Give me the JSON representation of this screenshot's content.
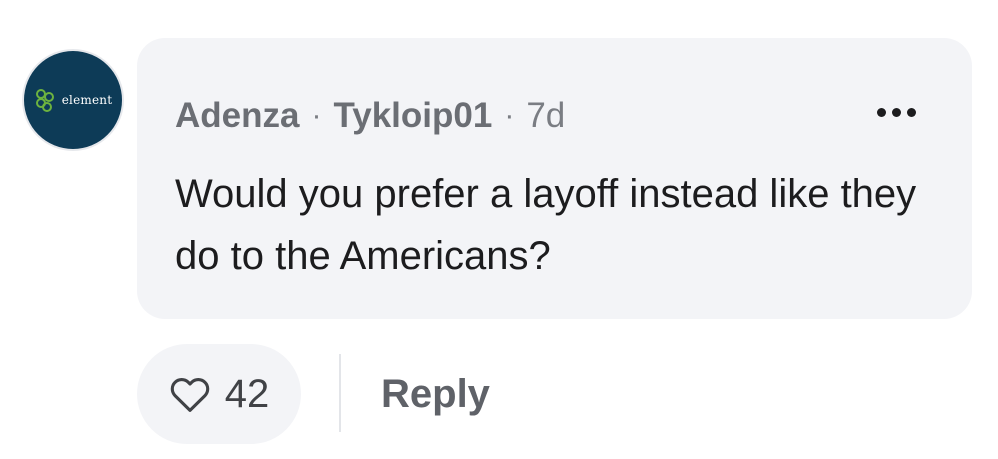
{
  "comment": {
    "avatar_logo_text": "element",
    "author": "Adenza",
    "separator": "·",
    "username": "Tykloip01",
    "age": "7d",
    "text": "Would you prefer a layoff instead like they do to the Americans?",
    "more_icon": "more-horizontal-icon"
  },
  "actions": {
    "like_icon": "heart-icon",
    "like_count": "42",
    "reply_label": "Reply"
  },
  "colors": {
    "avatar_bg": "#0d3b57",
    "logo_green": "#6db33f",
    "bubble_bg": "#f3f4f7",
    "meta_text": "#6b6e74"
  }
}
